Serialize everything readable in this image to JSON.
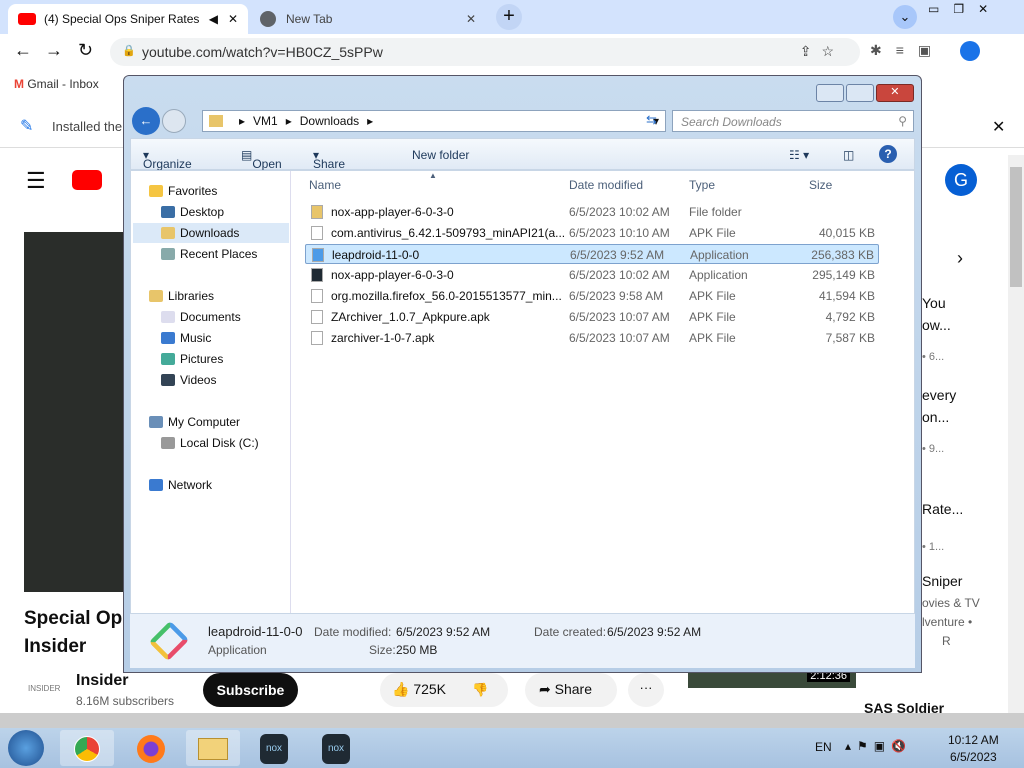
{
  "browser": {
    "tabs": [
      {
        "title": "(4) Special Ops Sniper Rates",
        "active": true
      },
      {
        "title": "New Tab",
        "active": false
      }
    ],
    "url": "youtube.com/watch?v=HB0CZ_5sPPw",
    "bookmarks": [
      "Gmail - Inbox"
    ],
    "infobar_text": "Installed the",
    "window_buttons": [
      "minimize",
      "restore",
      "close"
    ]
  },
  "explorer": {
    "breadcrumb": [
      "VM1",
      "Downloads"
    ],
    "search_placeholder": "Search Downloads",
    "toolbar": [
      "Organize",
      "Open",
      "Share with",
      "New folder"
    ],
    "tree": [
      {
        "label": "Favorites",
        "level": 0
      },
      {
        "label": "Desktop",
        "level": 1
      },
      {
        "label": "Downloads",
        "level": 1,
        "selected": true
      },
      {
        "label": "Recent Places",
        "level": 1
      },
      {
        "label": "Libraries",
        "level": 0
      },
      {
        "label": "Documents",
        "level": 1
      },
      {
        "label": "Music",
        "level": 1
      },
      {
        "label": "Pictures",
        "level": 1
      },
      {
        "label": "Videos",
        "level": 1
      },
      {
        "label": "My Computer",
        "level": 0
      },
      {
        "label": "Local Disk (C:)",
        "level": 1
      },
      {
        "label": "Network",
        "level": 0
      }
    ],
    "columns": [
      "Name",
      "Date modified",
      "Type",
      "Size"
    ],
    "files": [
      {
        "name": "nox-app-player-6-0-3-0",
        "date": "6/5/2023 10:02 AM",
        "type": "File folder",
        "size": ""
      },
      {
        "name": "com.antivirus_6.42.1-509793_minAPI21(a...",
        "date": "6/5/2023 10:10 AM",
        "type": "APK File",
        "size": "40,015 KB"
      },
      {
        "name": "leapdroid-11-0-0",
        "date": "6/5/2023 9:52 AM",
        "type": "Application",
        "size": "256,383 KB",
        "selected": true
      },
      {
        "name": "nox-app-player-6-0-3-0",
        "date": "6/5/2023 10:02 AM",
        "type": "Application",
        "size": "295,149 KB"
      },
      {
        "name": "org.mozilla.firefox_56.0-2015513577_min...",
        "date": "6/5/2023 9:58 AM",
        "type": "APK File",
        "size": "41,594 KB"
      },
      {
        "name": "ZArchiver_1.0.7_Apkpure.apk",
        "date": "6/5/2023 10:07 AM",
        "type": "APK File",
        "size": "4,792 KB"
      },
      {
        "name": "zarchiver-1-0-7.apk",
        "date": "6/5/2023 10:07 AM",
        "type": "APK File",
        "size": "7,587 KB"
      }
    ],
    "details": {
      "name": "leapdroid-11-0-0",
      "type": "Application",
      "date_modified_label": "Date modified:",
      "date_modified": "6/5/2023 9:52 AM",
      "size_label": "Size:",
      "size": "250 MB",
      "date_created_label": "Date created:",
      "date_created": "6/5/2023 9:52 AM"
    }
  },
  "youtube": {
    "title_line1": "Special Ops",
    "title_line2": "Insider",
    "channel": "Insider",
    "subscribers": "8.16M subscribers",
    "subscribe": "Subscribe",
    "likes": "725K",
    "share": "Share",
    "avatar": "G",
    "side": [
      "You",
      "ow...",
      "• 6...",
      "every",
      "on...",
      "• 9...",
      "Rate...",
      "• 1...",
      "Sniper",
      "ovies & TV",
      "lventure •",
      "R",
      "2:12:36",
      "SAS Soldier"
    ]
  },
  "taskbar": {
    "lang": "EN",
    "time": "10:12 AM",
    "date": "6/5/2023"
  }
}
